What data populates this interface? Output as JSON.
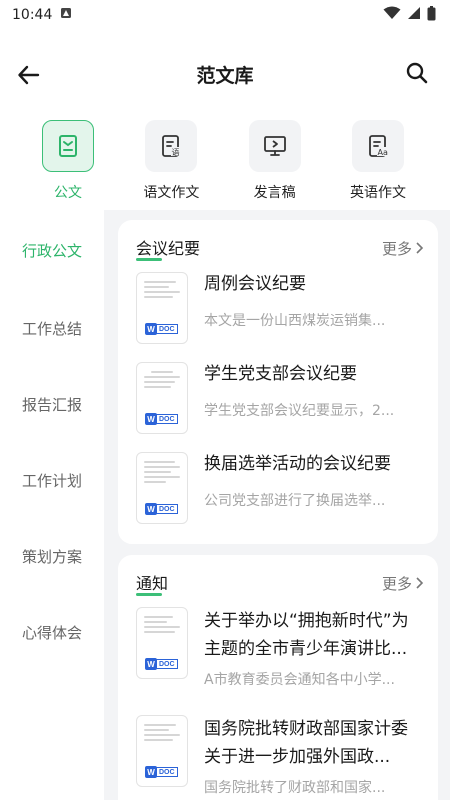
{
  "status": {
    "time": "10:44"
  },
  "nav": {
    "title": "范文库"
  },
  "categories": [
    {
      "label": "公文",
      "icon": "document-icon",
      "active": true
    },
    {
      "label": "语文作文",
      "icon": "chinese-essay-icon",
      "active": false
    },
    {
      "label": "发言稿",
      "icon": "speech-icon",
      "active": false
    },
    {
      "label": "英语作文",
      "icon": "english-essay-icon",
      "active": false
    }
  ],
  "sidebar": {
    "items": [
      {
        "label": "行政公文",
        "active": true
      },
      {
        "label": "工作总结",
        "active": false
      },
      {
        "label": "报告汇报",
        "active": false
      },
      {
        "label": "工作计划",
        "active": false
      },
      {
        "label": "策划方案",
        "active": false
      },
      {
        "label": "心得体会",
        "active": false
      }
    ]
  },
  "sections": [
    {
      "title": "会议纪要",
      "more": "更多",
      "docs": [
        {
          "title": "周例会议纪要",
          "desc": "本文是一份山西煤炭运销集..."
        },
        {
          "title": "学生党支部会议纪要",
          "desc": "学生党支部会议纪要显示，2..."
        },
        {
          "title": "换届选举活动的会议纪要",
          "desc": "公司党支部进行了换届选举..."
        }
      ]
    },
    {
      "title": "通知",
      "more": "更多",
      "docs": [
        {
          "title": "关于举办以“拥抱新时代”为主题的全市青少年演讲比...",
          "desc": "A市教育委员会通知各中小学..."
        },
        {
          "title": "国务院批转财政部国家计委关于进一步加强外国政...",
          "desc": "国务院批转了财政部和国家..."
        }
      ]
    }
  ],
  "badge": {
    "w": "W",
    "doc": "DOC"
  },
  "colors": {
    "accent": "#2db46a",
    "accent_bg": "#e3f5eb",
    "badge_blue": "#2b63d8"
  }
}
